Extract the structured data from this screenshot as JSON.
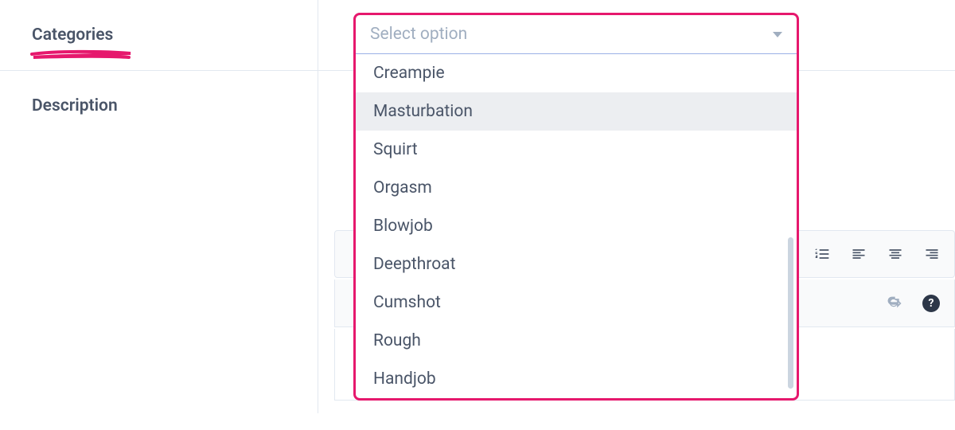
{
  "form": {
    "categories_label": "Categories",
    "description_label": "Description"
  },
  "dropdown": {
    "placeholder": "Select option",
    "options": [
      "Creampie",
      "Masturbation",
      "Squirt",
      "Orgasm",
      "Blowjob",
      "Deepthroat",
      "Cumshot",
      "Rough",
      "Handjob"
    ],
    "highlighted_index": 1
  },
  "accent_color": "#e6186d"
}
